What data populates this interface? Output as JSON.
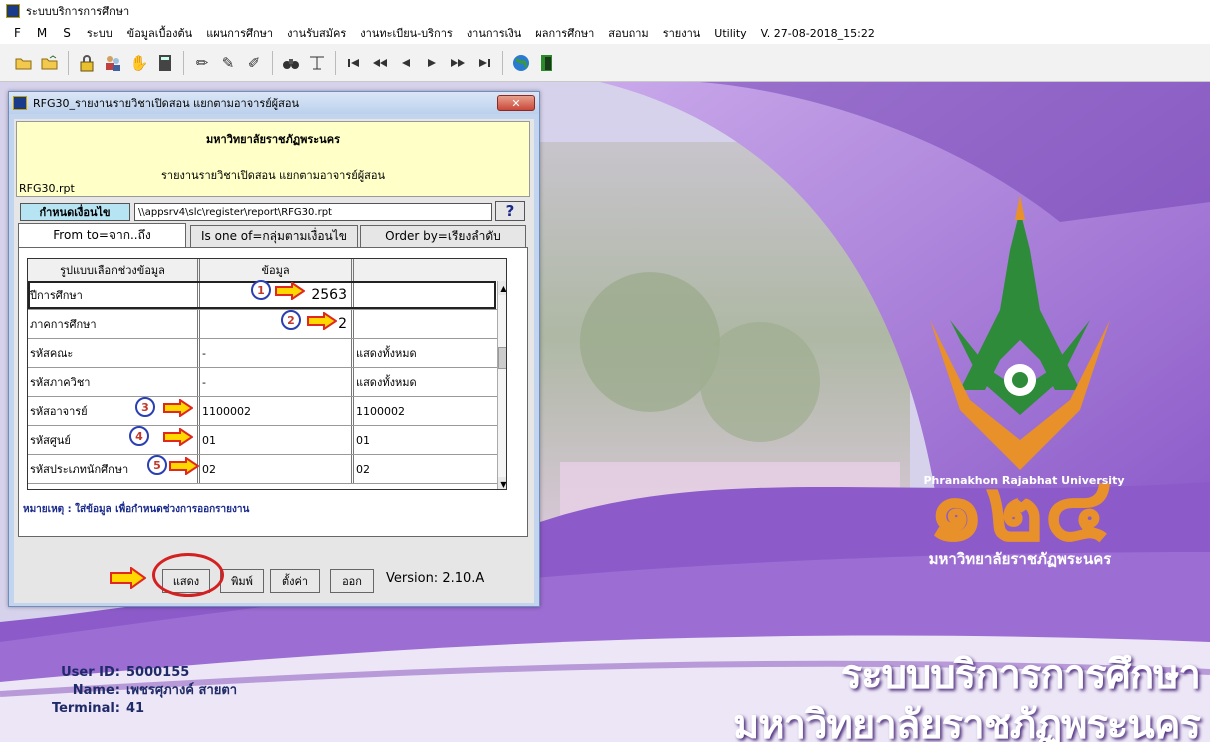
{
  "app": {
    "title": "ระบบบริการการศึกษา"
  },
  "menu": [
    "F",
    "M",
    "S",
    "ระบบ",
    "ข้อมูลเบื้องต้น",
    "แผนการศึกษา",
    "งานรับสมัคร",
    "งานทะเบียน-บริการ",
    "งานการเงิน",
    "ผลการศึกษา",
    "สอบถาม",
    "รายงาน",
    "Utility",
    "V. 27-08-2018_15:22"
  ],
  "toolbar_icons": [
    "open-folder-icon",
    "folder-up-icon",
    "lock-icon",
    "users-icon",
    "hand-icon",
    "calculator-icon",
    "pencil-icon",
    "pencil-add-icon",
    "pencil-remove-icon",
    "binoculars-icon",
    "filter-icon",
    "first-record-icon",
    "prev-page-icon",
    "prev-record-icon",
    "next-record-icon",
    "next-page-icon",
    "last-record-icon",
    "globe-icon",
    "exit-icon"
  ],
  "dialog": {
    "title": "RFG30_รายงานรายวิชาเปิดสอน แยกตามอาจารย์ผู้สอน",
    "close": "✕",
    "university": "มหาวิทยาลัยราชภัฏพระนคร",
    "report_name": "รายงานรายวิชาเปิดสอน แยกตามอาจารย์ผู้สอน",
    "report_file": "RFG30.rpt",
    "condition_label": "กำหนดเงื่อนไข",
    "path": "\\\\appsrv4\\slc\\register\\report\\RFG30.rpt",
    "help": "?",
    "tabs": [
      "From to=จาก..ถึง",
      "Is one of=กลุ่มตามเงื่อนไข",
      "Order by=เรียงลำดับ"
    ],
    "grid": {
      "headers": [
        "รูปแบบเลือกช่วงข้อมูล",
        "ข้อมูล",
        ""
      ],
      "rows": [
        {
          "label": "ปีการศึกษา",
          "from": "2563",
          "to": ""
        },
        {
          "label": "ภาคการศึกษา",
          "from": "2",
          "to": ""
        },
        {
          "label": "รหัสคณะ",
          "from": "-",
          "to": "แสดงทั้งหมด"
        },
        {
          "label": "รหัสภาควิชา",
          "from": "-",
          "to": "แสดงทั้งหมด"
        },
        {
          "label": "รหัสอาจารย์",
          "from": "1100002",
          "to": "1100002"
        },
        {
          "label": "รหัสศูนย์",
          "from": "01",
          "to": "01"
        },
        {
          "label": "รหัสประเภทนักศึกษา",
          "from": "02",
          "to": "02"
        }
      ]
    },
    "step_badges": [
      "1",
      "2",
      "3",
      "4",
      "5"
    ],
    "note": "หมายเหตุ : ใส่ข้อมูล เพื่อกำหนดช่วงการออกรายงาน",
    "buttons": {
      "show": "แสดง",
      "print": "พิมพ์",
      "setup": "ตั้งค่า",
      "exit": "ออก"
    },
    "version": "Version: 2.10.A"
  },
  "background": {
    "logo_en": "Phranakhon Rajabhat University",
    "logo_th": "มหาวิทยาลัยราชภัฏพระนคร",
    "title1": "ระบบบริการการศึกษา",
    "title2": "มหาวิทยาลัยราชภัฏพระนคร"
  },
  "user": {
    "id_label": "User ID:",
    "id": "5000155",
    "name_label": "Name:",
    "name": "เพชรศุภางค์ สายตา",
    "terminal_label": "Terminal:",
    "terminal": "41"
  },
  "colors": {
    "accent_purple": "#8b5cc8",
    "logo_green": "#2e8b3a",
    "logo_orange": "#e8902a",
    "arrow_red": "#e0281e",
    "arrow_yellow": "#ffd800"
  }
}
